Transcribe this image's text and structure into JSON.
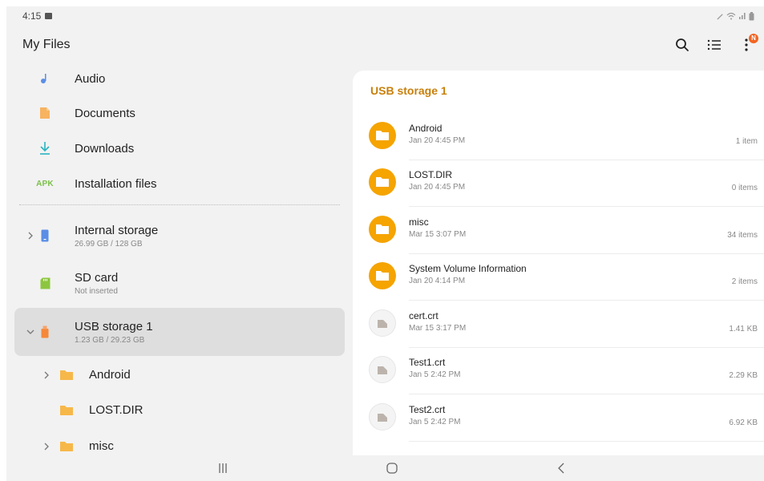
{
  "status_bar": {
    "time": "4:15"
  },
  "header": {
    "title": "My Files",
    "badge": "N"
  },
  "left_nav": {
    "items": [
      {
        "label": "Audio"
      },
      {
        "label": "Documents"
      },
      {
        "label": "Downloads"
      },
      {
        "label": "Installation files",
        "icon_text": "APK"
      }
    ],
    "storage": [
      {
        "label": "Internal storage",
        "sub": "26.99 GB / 128 GB"
      },
      {
        "label": "SD card",
        "sub": "Not inserted"
      },
      {
        "label": "USB storage 1",
        "sub": "1.23 GB / 29.23 GB"
      }
    ],
    "sub_folders": [
      {
        "label": "Android"
      },
      {
        "label": "LOST.DIR"
      },
      {
        "label": "misc"
      }
    ]
  },
  "content": {
    "location": "USB storage 1",
    "files": [
      {
        "name": "Android",
        "date": "Jan 20 4:45 PM",
        "size": "1 item"
      },
      {
        "name": "LOST.DIR",
        "date": "Jan 20 4:45 PM",
        "size": "0 items"
      },
      {
        "name": "misc",
        "date": "Mar 15 3:07 PM",
        "size": "34 items"
      },
      {
        "name": "System Volume Information",
        "date": "Jan 20 4:14 PM",
        "size": "2 items"
      },
      {
        "name": "cert.crt",
        "date": "Mar 15 3:17 PM",
        "size": "1.41 KB"
      },
      {
        "name": "Test1.crt",
        "date": "Jan 5 2:42 PM",
        "size": "2.29 KB"
      },
      {
        "name": "Test2.crt",
        "date": "Jan 5 2:42 PM",
        "size": "6.92 KB"
      }
    ]
  },
  "colors": {
    "accent": "#c87f0a",
    "folder": "#f5a400",
    "selected_bg": "#dedede",
    "panel_bg": "#f2f2f2"
  },
  "icons": {
    "header": [
      "search-icon",
      "list-view-icon",
      "more-options-icon"
    ],
    "nav_bar": [
      "recent-apps-icon",
      "home-icon",
      "back-icon"
    ]
  }
}
